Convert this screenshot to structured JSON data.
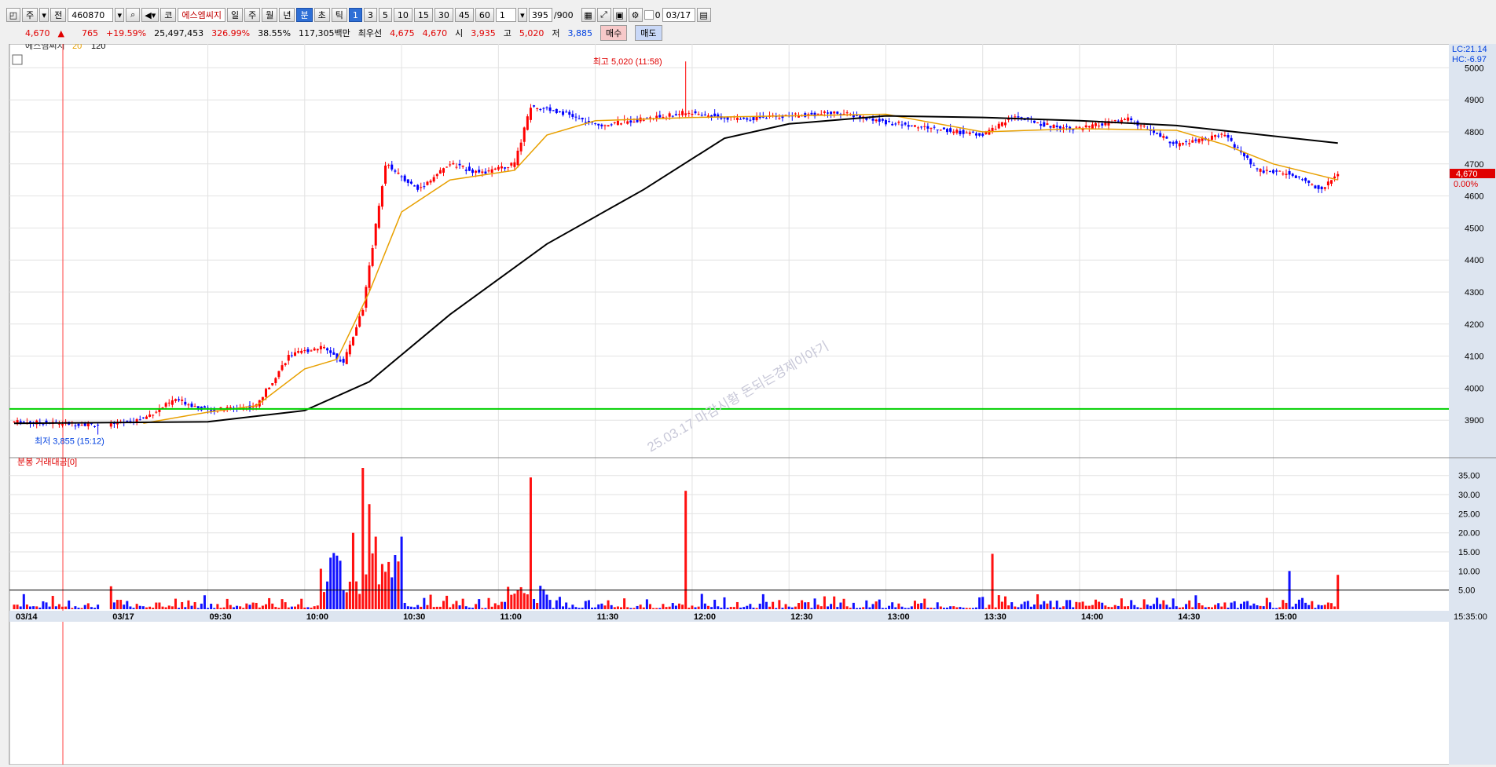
{
  "toolbar": {
    "market": "주",
    "scope": "전",
    "code": "460870",
    "prefix": "코",
    "name": "에스엠씨지",
    "periods": [
      "일",
      "주",
      "월",
      "년",
      "분",
      "초",
      "틱"
    ],
    "active_period": "분",
    "intervals": [
      "1",
      "3",
      "5",
      "10",
      "15",
      "30",
      "45",
      "60"
    ],
    "active_interval": "1",
    "multiplier": "1",
    "count": "395",
    "count_max": "/900",
    "check_label": "0",
    "date": "03/17"
  },
  "quote": {
    "price": "4,670",
    "arrow": "▲",
    "change": "765",
    "change_pct": "+19.59%",
    "volume": "25,497,453",
    "vol_ratio": "326.99%",
    "turnover": "38.55%",
    "amount": "117,305백만",
    "best_label": "최우선",
    "best_ask": "4,675",
    "best_bid": "4,670",
    "open_label": "시",
    "open": "3,935",
    "high_label": "고",
    "high": "5,020",
    "low_label": "저",
    "low": "3,885",
    "buy_label": "매수",
    "sell_label": "매도"
  },
  "price_panel": {
    "legend_name": "에스엠씨지",
    "ma1_label": "20",
    "ma2_label": "120",
    "lc_label": "LC:21.14",
    "hc_label": "HC:-6.97",
    "current_tag": "4,670",
    "pct_tag": "0.00%",
    "high_annotation": "최고 5,020 (11:58)",
    "low_annotation": "최저 3,855 (15:12)",
    "watermark": "25.03.17 마감시황 돈되는경제이야기",
    "colors": {
      "up": "#ff0000",
      "down": "#0000ff",
      "ma20": "#e8a000",
      "ma120": "#000000",
      "hline": "#00d000"
    }
  },
  "volume_panel": {
    "legend": "분봉 거래대금[0]",
    "end_time": "15:35:00"
  },
  "chart_data": [
    {
      "type": "candlestick",
      "title": "",
      "x": [
        "03/14",
        "03/17",
        "09:30",
        "10:00",
        "10:30",
        "11:00",
        "11:30",
        "12:00",
        "12:30",
        "13:00",
        "13:30",
        "14:00",
        "14:30",
        "15:00"
      ],
      "ylim": [
        3800,
        5050
      ],
      "yticks": [
        3900,
        4000,
        4100,
        4200,
        4300,
        4400,
        4500,
        4600,
        4700,
        4800,
        4900,
        5000
      ],
      "horizontal_line": 3935,
      "high": 5020,
      "low": 3855,
      "close_points": [
        [
          "03/14",
          3895
        ],
        [
          "03/17",
          3885
        ],
        [
          "09:10",
          3905
        ],
        [
          "09:20",
          3965
        ],
        [
          "09:30",
          3930
        ],
        [
          "09:45",
          3945
        ],
        [
          "09:55",
          4100
        ],
        [
          "10:05",
          4130
        ],
        [
          "10:12",
          4080
        ],
        [
          "10:18",
          4250
        ],
        [
          "10:25",
          4700
        ],
        [
          "10:35",
          4620
        ],
        [
          "10:45",
          4700
        ],
        [
          "10:55",
          4670
        ],
        [
          "11:05",
          4700
        ],
        [
          "11:10",
          4880
        ],
        [
          "11:20",
          4860
        ],
        [
          "11:30",
          4820
        ],
        [
          "11:45",
          4840
        ],
        [
          "11:58",
          4860
        ],
        [
          "12:15",
          4840
        ],
        [
          "12:30",
          4850
        ],
        [
          "12:45",
          4860
        ],
        [
          "13:00",
          4830
        ],
        [
          "13:15",
          4810
        ],
        [
          "13:30",
          4790
        ],
        [
          "13:40",
          4850
        ],
        [
          "13:50",
          4820
        ],
        [
          "14:00",
          4810
        ],
        [
          "14:15",
          4840
        ],
        [
          "14:30",
          4760
        ],
        [
          "14:45",
          4790
        ],
        [
          "14:55",
          4680
        ],
        [
          "15:05",
          4670
        ],
        [
          "15:15",
          4620
        ],
        [
          "15:20",
          4670
        ]
      ],
      "series": [
        {
          "name": "20",
          "values": [
            [
              "09:10",
              3890
            ],
            [
              "09:30",
              3925
            ],
            [
              "09:45",
              3945
            ],
            [
              "10:00",
              4060
            ],
            [
              "10:10",
              4090
            ],
            [
              "10:20",
              4300
            ],
            [
              "10:30",
              4550
            ],
            [
              "10:45",
              4650
            ],
            [
              "11:05",
              4680
            ],
            [
              "11:15",
              4790
            ],
            [
              "11:30",
              4835
            ],
            [
              "12:00",
              4845
            ],
            [
              "13:00",
              4855
            ],
            [
              "13:30",
              4800
            ],
            [
              "14:00",
              4810
            ],
            [
              "14:30",
              4805
            ],
            [
              "14:45",
              4760
            ],
            [
              "15:00",
              4700
            ],
            [
              "15:20",
              4650
            ]
          ]
        },
        {
          "name": "120",
          "values": [
            [
              "03/14",
              3890
            ],
            [
              "09:30",
              3895
            ],
            [
              "10:00",
              3930
            ],
            [
              "10:20",
              4020
            ],
            [
              "10:45",
              4230
            ],
            [
              "11:15",
              4450
            ],
            [
              "11:45",
              4620
            ],
            [
              "12:10",
              4780
            ],
            [
              "12:30",
              4825
            ],
            [
              "13:00",
              4850
            ],
            [
              "13:30",
              4845
            ],
            [
              "14:00",
              4835
            ],
            [
              "14:30",
              4820
            ],
            [
              "15:20",
              4765
            ]
          ]
        }
      ]
    },
    {
      "type": "bar",
      "title": "분봉 거래대금[0]",
      "ylim": [
        0,
        37
      ],
      "yticks": [
        5,
        10,
        15,
        20,
        25,
        30,
        35
      ],
      "yticklabels": [
        "5.00",
        "10.00",
        "15.00",
        "20.00",
        "25.00",
        "30.00",
        "35.00"
      ],
      "reference_line": 5,
      "peaks": [
        {
          "x": "03/17",
          "value": 6
        },
        {
          "x": "10:15",
          "value": 20
        },
        {
          "x": "10:18",
          "value": 37
        },
        {
          "x": "10:20",
          "value": 27.5
        },
        {
          "x": "10:22",
          "value": 19
        },
        {
          "x": "10:30",
          "value": 19
        },
        {
          "x": "11:10",
          "value": 34.5
        },
        {
          "x": "11:58",
          "value": 31
        },
        {
          "x": "13:33",
          "value": 14.5
        },
        {
          "x": "15:05",
          "value": 10
        },
        {
          "x": "15:20",
          "value": 9
        }
      ]
    }
  ]
}
